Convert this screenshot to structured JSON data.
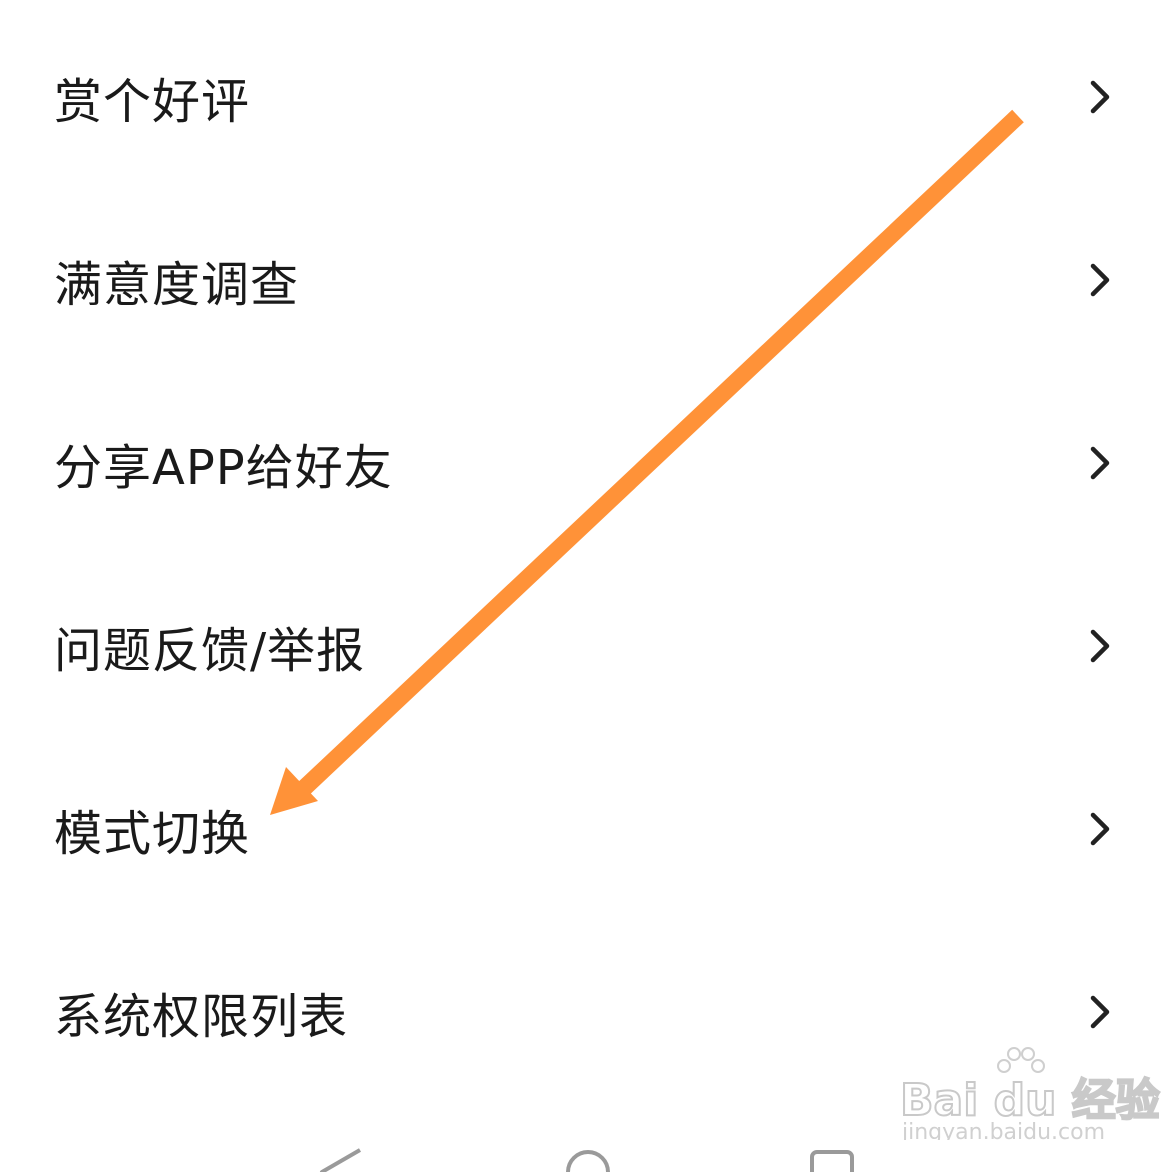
{
  "menu": {
    "items": [
      {
        "label": "赏个好评"
      },
      {
        "label": "满意度调查"
      },
      {
        "label": "分享APP给好友"
      },
      {
        "label": "问题反馈/举报"
      },
      {
        "label": "模式切换"
      },
      {
        "label": "系统权限列表"
      }
    ]
  },
  "icons": {
    "row_arrow": "chevron-right-icon",
    "annotation": "orange-arrow",
    "nav_back": "back-triangle-icon",
    "nav_home": "home-circle-icon",
    "nav_recents": "recents-square-icon"
  },
  "colors": {
    "text": "#1a1a1a",
    "chevron": "#222222",
    "annotation_arrow": "#ff9238",
    "background": "#ffffff"
  },
  "watermark": {
    "brand": "Bai du 经验",
    "url": "jingyan.baidu.com"
  }
}
